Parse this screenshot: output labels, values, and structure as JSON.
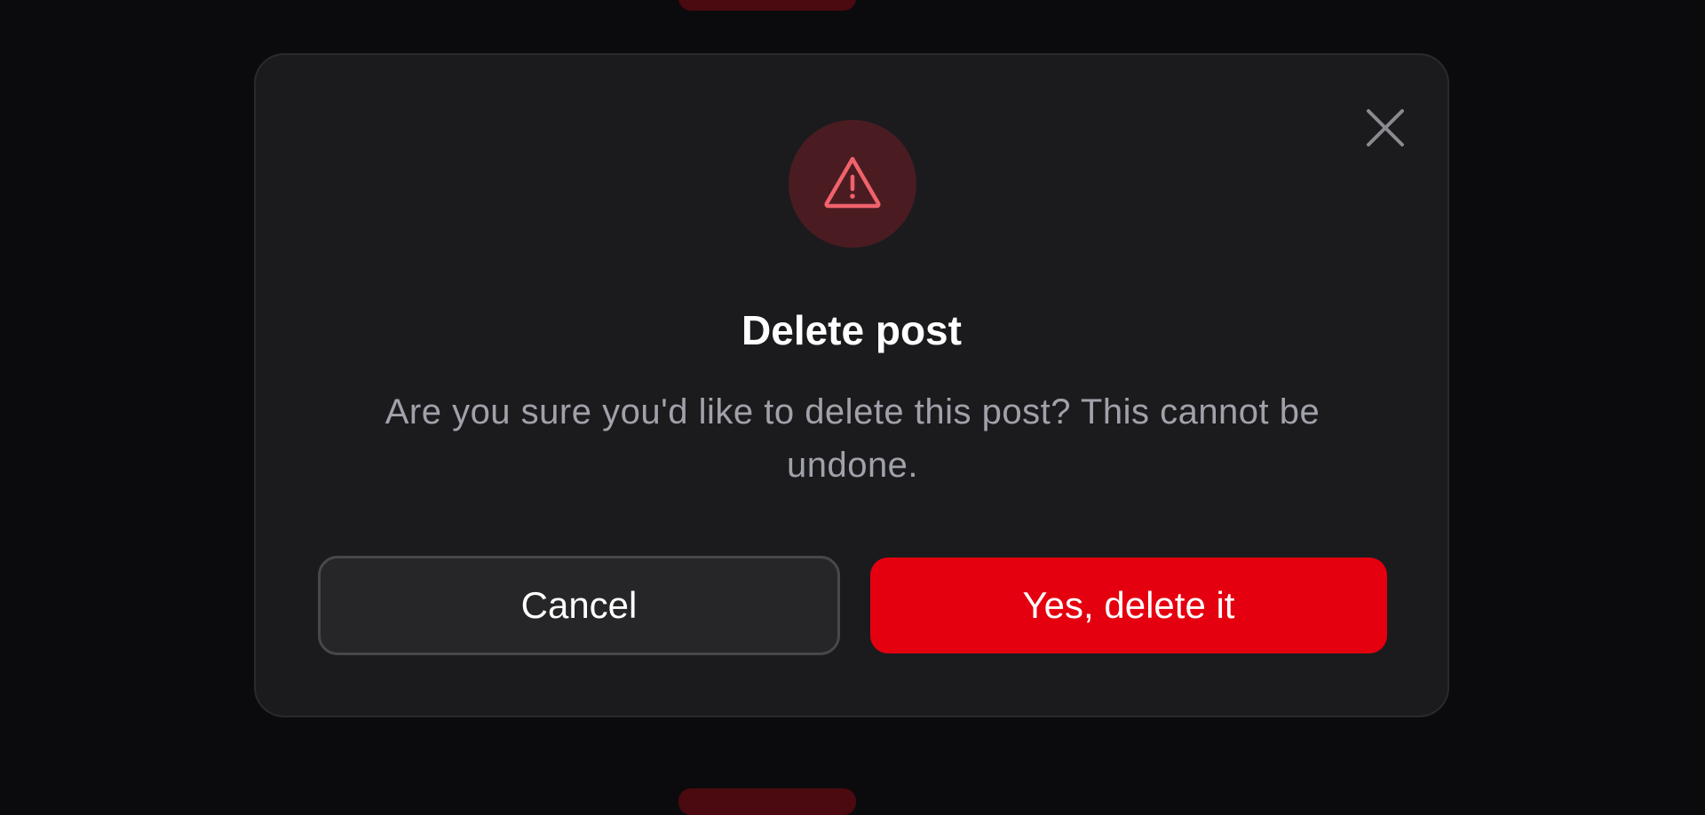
{
  "dialog": {
    "title": "Delete post",
    "message": "Are you sure you'd like to delete this post? This cannot be undone.",
    "cancel_label": "Cancel",
    "confirm_label": "Yes, delete it",
    "icon": "warning-triangle-icon",
    "close_icon": "close-icon"
  },
  "colors": {
    "danger": "#e5000f",
    "warning_icon": "#f0626c",
    "warning_bg": "#4a1c21",
    "surface": "#1b1b1e",
    "backdrop": "#0b0b0d",
    "muted_text": "#a1a1aa"
  }
}
